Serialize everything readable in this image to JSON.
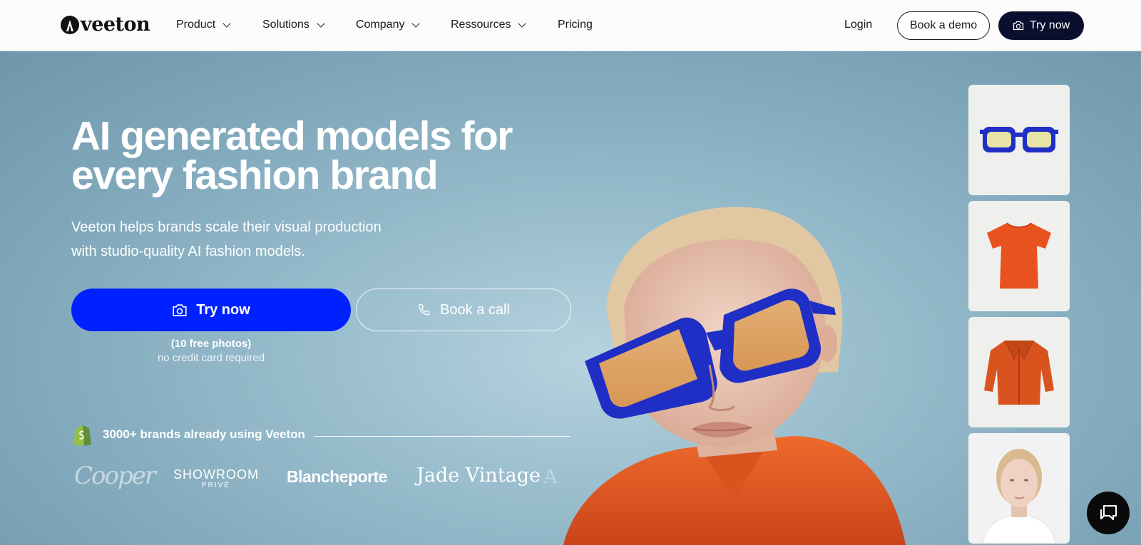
{
  "nav": {
    "logo_text": "veeton",
    "items": [
      {
        "label": "Product"
      },
      {
        "label": "Solutions"
      },
      {
        "label": "Company"
      },
      {
        "label": "Ressources"
      },
      {
        "label": "Pricing"
      }
    ],
    "login": "Login",
    "book_demo": "Book a demo",
    "try_now": "Try now"
  },
  "hero": {
    "title": "AI generated models for every fashion brand",
    "subtitle": "Veeton helps brands scale their visual production with studio-quality AI fashion models.",
    "cta_primary": "Try now",
    "cta_secondary": "Book a call",
    "free_note": "(10 free photos)",
    "credit_note": "no credit card required",
    "brands_text": "3000+ brands already using Veeton",
    "brand_logos": {
      "cooper": "Cooper",
      "showroom": "SHOWROOM",
      "showroom_sub": "PRIVÉ",
      "blancheporte": "Blancheporte",
      "jade": "Jade Vintage",
      "partial": "A"
    }
  },
  "thumbnails": [
    {
      "name": "sunglasses"
    },
    {
      "name": "orange-tshirt"
    },
    {
      "name": "orange-jacket"
    },
    {
      "name": "model-portrait"
    }
  ],
  "colors": {
    "primary": "#0021ff",
    "dark": "#0a0f2e",
    "hero_bg": "#8fb4c6",
    "accent_orange": "#e2561f",
    "glasses_blue": "#1f2ec4"
  },
  "icons": [
    "camera-icon",
    "phone-icon",
    "chevron-down-icon",
    "shopify-icon",
    "chat-icon"
  ]
}
